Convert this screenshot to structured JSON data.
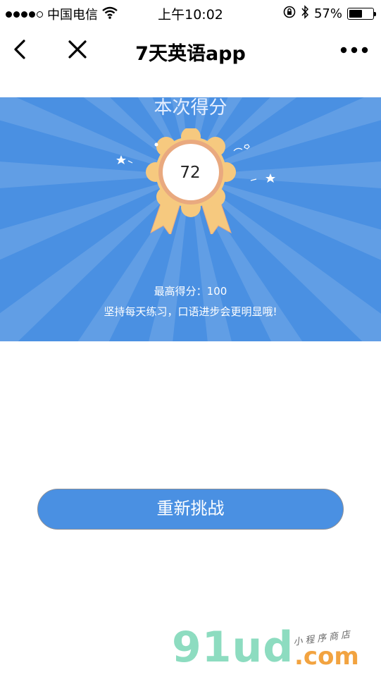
{
  "status_bar": {
    "carrier": "中国电信",
    "time": "上午10:02",
    "battery_percent": "57%",
    "battery_level": 0.57,
    "icons": [
      "signal-dots-icon",
      "wifi-icon",
      "rotation-lock-icon",
      "bluetooth-icon",
      "battery-icon"
    ]
  },
  "nav": {
    "title": "7天英语app",
    "icons": [
      "back-arrow-icon",
      "close-icon",
      "more-icon"
    ]
  },
  "result": {
    "heading": "本次得分",
    "score": "72",
    "best_score": "最高得分：100",
    "tip": "坚持每天练习，口语进步会更明显哦!"
  },
  "actions": {
    "retry_label": "重新挑战"
  },
  "watermark": {
    "brand": "91ud",
    "domain_suffix": ".com",
    "tagline": "小程序商店"
  },
  "colors": {
    "banner": "#4a90e2",
    "button": "#4a90e2",
    "medal": "#f6c97f",
    "medal_ring": "#e9a97f"
  }
}
